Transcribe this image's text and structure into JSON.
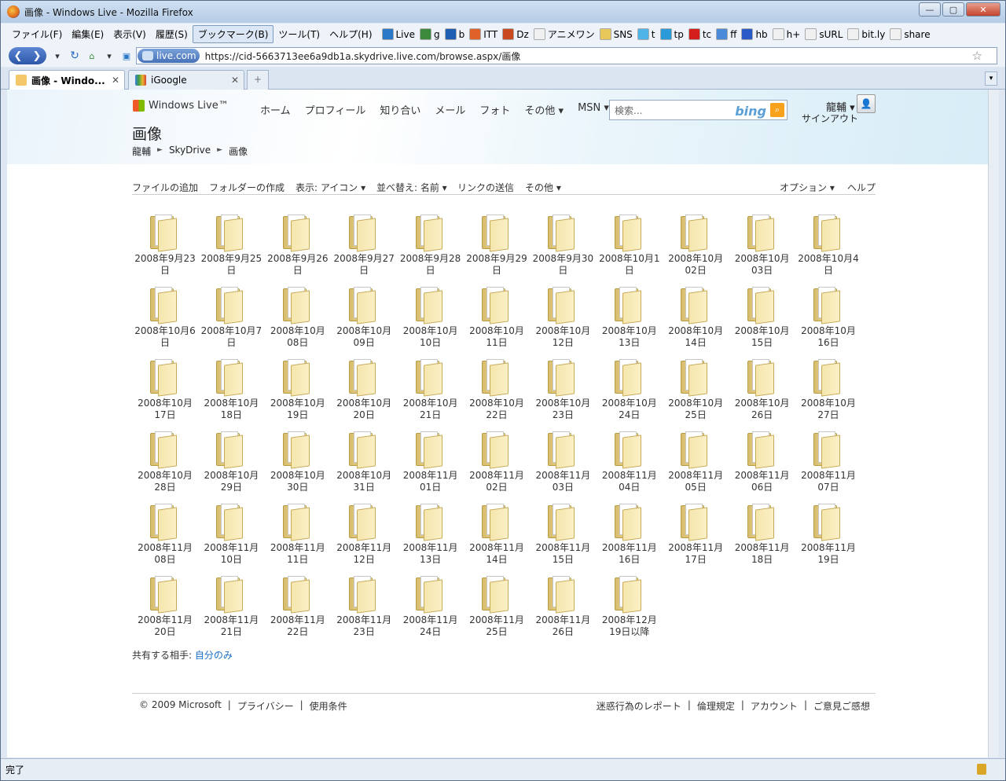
{
  "window": {
    "title": "画像 - Windows Live - Mozilla Firefox"
  },
  "menu": [
    "ファイル(F)",
    "編集(E)",
    "表示(V)",
    "履歴(S)",
    "ブックマーク(B)",
    "ツール(T)",
    "ヘルプ(H)"
  ],
  "bookmarks": [
    {
      "label": "Live",
      "color": "#2a78c8"
    },
    {
      "label": "g",
      "color": "#3b8a3b"
    },
    {
      "label": "b",
      "color": "#1e5fb4"
    },
    {
      "label": "ITT",
      "color": "#e0622a"
    },
    {
      "label": "Dz",
      "color": "#c84a1e"
    },
    {
      "label": "アニメワン",
      "color": "#f0f0f0"
    },
    {
      "label": "SNS",
      "color": "#e8c85a"
    },
    {
      "label": "t",
      "color": "#4fb4e8"
    },
    {
      "label": "tp",
      "color": "#2a9ad8"
    },
    {
      "label": "tc",
      "color": "#d41e1e"
    },
    {
      "label": "ff",
      "color": "#4a8ad8"
    },
    {
      "label": "hb",
      "color": "#2a5ac8"
    },
    {
      "label": "h+",
      "color": "#f0f0f0"
    },
    {
      "label": "sURL",
      "color": "#f0f0f0"
    },
    {
      "label": "bit.ly",
      "color": "#f0f0f0"
    },
    {
      "label": "share",
      "color": "#f0f0f0"
    }
  ],
  "nav": {
    "site_identity": "live.com",
    "url": "https://cid-5663713ee6a9db1a.skydrive.live.com/browse.aspx/画像"
  },
  "tabs": [
    {
      "label": "画像 - Windo...",
      "active": true
    },
    {
      "label": "iGoogle",
      "active": false
    }
  ],
  "header": {
    "logo": "Windows Live™",
    "nav": [
      "ホーム",
      "プロフィール",
      "知り合い",
      "メール",
      "フォト",
      "その他 ▾",
      "MSN ▾"
    ],
    "search_placeholder": "検索...",
    "search_brand": "bing",
    "user": "龍輔 ▾",
    "signout": "サインアウト"
  },
  "page": {
    "title": "画像",
    "breadcrumb": [
      "龍輔",
      "SkyDrive",
      "画像"
    ],
    "breadcrumb_sep": "►"
  },
  "toolbar": {
    "add_files": "ファイルの追加",
    "new_folder": "フォルダーの作成",
    "view": "表示: アイコン ▾",
    "sort": "並べ替え: 名前 ▾",
    "send_link": "リンクの送信",
    "more": "その他 ▾",
    "options": "オプション ▾",
    "help": "ヘルプ"
  },
  "folders": [
    "2008年9月23日",
    "2008年9月25日",
    "2008年9月26日",
    "2008年9月27日",
    "2008年9月28日",
    "2008年9月29日",
    "2008年9月30日",
    "2008年10月1日",
    "2008年10月02日",
    "2008年10月03日",
    "2008年10月4日",
    "2008年10月6日",
    "2008年10月7日",
    "2008年10月08日",
    "2008年10月09日",
    "2008年10月10日",
    "2008年10月11日",
    "2008年10月12日",
    "2008年10月13日",
    "2008年10月14日",
    "2008年10月15日",
    "2008年10月16日",
    "2008年10月17日",
    "2008年10月18日",
    "2008年10月19日",
    "2008年10月20日",
    "2008年10月21日",
    "2008年10月22日",
    "2008年10月23日",
    "2008年10月24日",
    "2008年10月25日",
    "2008年10月26日",
    "2008年10月27日",
    "2008年10月28日",
    "2008年10月29日",
    "2008年10月30日",
    "2008年10月31日",
    "2008年11月01日",
    "2008年11月02日",
    "2008年11月03日",
    "2008年11月04日",
    "2008年11月05日",
    "2008年11月06日",
    "2008年11月07日",
    "2008年11月08日",
    "2008年11月10日",
    "2008年11月11日",
    "2008年11月12日",
    "2008年11月13日",
    "2008年11月14日",
    "2008年11月15日",
    "2008年11月16日",
    "2008年11月17日",
    "2008年11月18日",
    "2008年11月19日",
    "2008年11月20日",
    "2008年11月21日",
    "2008年11月22日",
    "2008年11月23日",
    "2008年11月24日",
    "2008年11月25日",
    "2008年11月26日",
    "2008年12月19日以降"
  ],
  "sharing": {
    "label": "共有する相手:",
    "value": "自分のみ"
  },
  "footer": {
    "left": [
      "© 2009 Microsoft",
      "プライバシー",
      "使用条件"
    ],
    "right": [
      "迷惑行為のレポート",
      "倫理規定",
      "アカウント",
      "ご意見ご感想"
    ]
  },
  "status": {
    "text": "完了"
  }
}
